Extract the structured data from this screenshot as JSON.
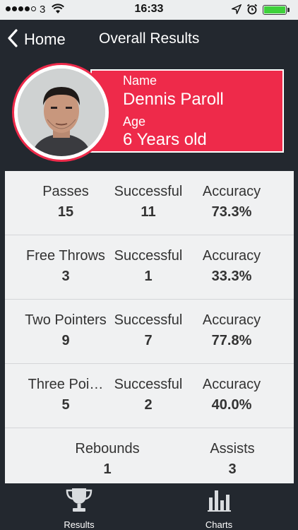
{
  "status_bar": {
    "carrier": "3",
    "time": "16:33"
  },
  "nav": {
    "back_label": "Home",
    "title": "Overall Results"
  },
  "profile": {
    "name_label": "Name",
    "name": "Dennis Paroll",
    "age_label": "Age",
    "age": "6 Years old"
  },
  "stats": {
    "passes": {
      "label": "Passes",
      "value": "15",
      "successful_label": "Successful",
      "successful": "11",
      "accuracy_label": "Accuracy",
      "accuracy": "73.3%"
    },
    "free_throws": {
      "label": "Free Throws",
      "value": "3",
      "successful_label": "Successful",
      "successful": "1",
      "accuracy_label": "Accuracy",
      "accuracy": "33.3%"
    },
    "two_pointers": {
      "label": "Two Pointers",
      "value": "9",
      "successful_label": "Successful",
      "successful": "7",
      "accuracy_label": "Accuracy",
      "accuracy": "77.8%"
    },
    "three_pointers": {
      "label": "Three Poi…",
      "value": "5",
      "successful_label": "Successful",
      "successful": "2",
      "accuracy_label": "Accuracy",
      "accuracy": "40.0%"
    },
    "rebounds": {
      "label": "Rebounds",
      "value": "1"
    },
    "assists": {
      "label": "Assists",
      "value": "3"
    }
  },
  "tabs": [
    {
      "label": "Results",
      "icon": "trophy-icon"
    },
    {
      "label": "Charts",
      "icon": "bar-chart-icon"
    }
  ],
  "colors": {
    "accent": "#ee2a4a",
    "background": "#23282f",
    "panel": "#f0f1f2"
  }
}
